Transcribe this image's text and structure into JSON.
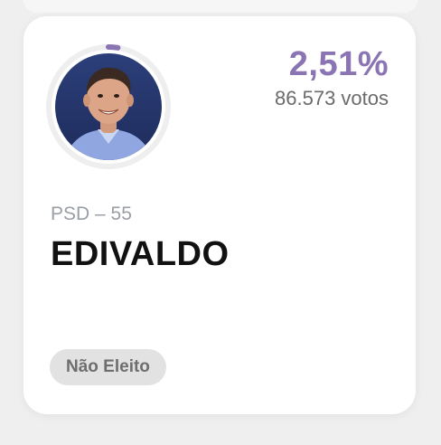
{
  "candidate": {
    "percentage": "2,51%",
    "votes": "86.573 votos",
    "party": "PSD – 55",
    "name": "EDIVALDO",
    "status": "Não Eleito",
    "vote_share_fraction": 0.0251
  },
  "colors": {
    "accent": "#8a74b3",
    "ring_track": "#eeeeee",
    "status_bg": "#e2e2e2"
  }
}
